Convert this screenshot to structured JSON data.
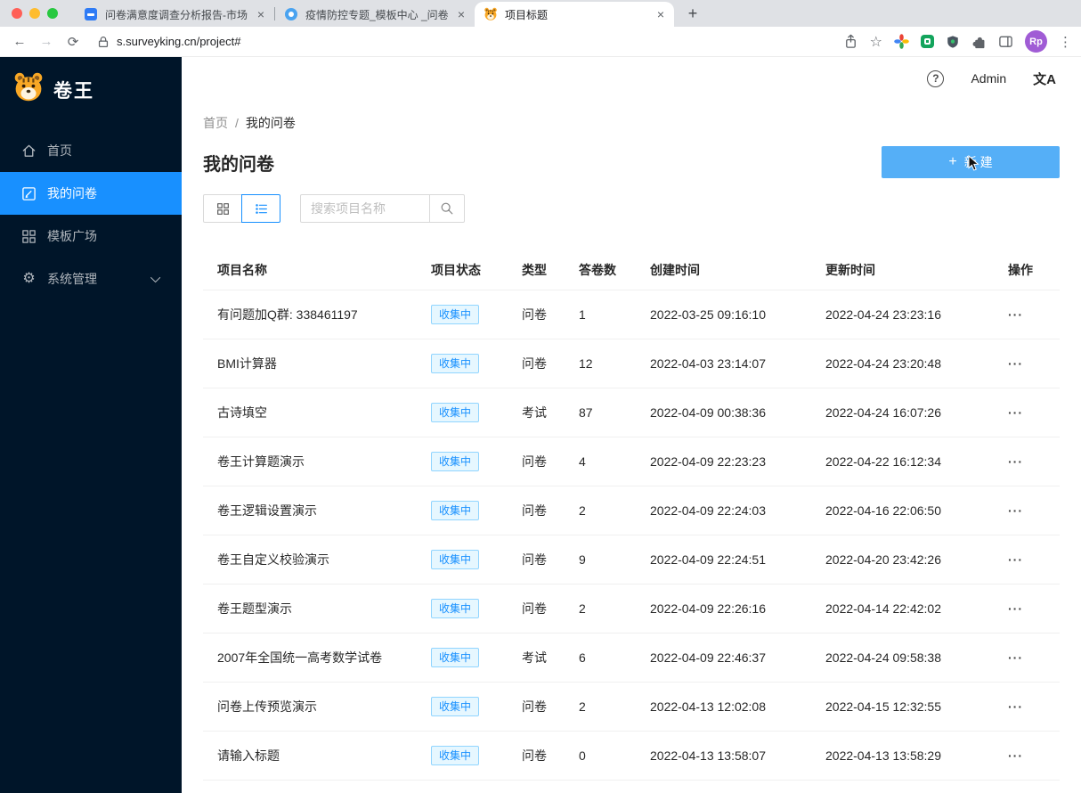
{
  "colors": {
    "accent": "#1890ff",
    "new_button_blue": "#55aff7",
    "badge_bg": "#e6f7ff",
    "badge_border": "#91d5ff",
    "sidebar_bg": "#001529",
    "avatar_purple": "#a05cd5"
  },
  "browser": {
    "tabs": [
      {
        "title": "问卷满意度调查分析报告-市场调"
      },
      {
        "title": "疫情防控专题_模板中心 _问卷网"
      },
      {
        "title": "项目标题"
      }
    ],
    "url": "s.surveyking.cn/project#",
    "avatar_initials": "Rp"
  },
  "icons": {
    "back": "←",
    "forward": "→",
    "refresh": "⟳",
    "star": "☆",
    "overflow": "⋮",
    "close": "×",
    "new_tab": "+",
    "plus": "+",
    "help": "?",
    "translate": "文A",
    "gear": "⚙",
    "more": "···"
  },
  "sidebar": {
    "logo": "卷王",
    "items": [
      {
        "label": "首页"
      },
      {
        "label": "我的问卷"
      },
      {
        "label": "模板广场"
      },
      {
        "label": "系统管理"
      }
    ]
  },
  "header": {
    "user": "Admin"
  },
  "breadcrumb": {
    "home": "首页",
    "separator": "/",
    "current": "我的问卷"
  },
  "page": {
    "title": "我的问卷",
    "new_button": "新 建",
    "search_placeholder": "搜索项目名称"
  },
  "table": {
    "columns": [
      "项目名称",
      "项目状态",
      "类型",
      "答卷数",
      "创建时间",
      "更新时间",
      "操作"
    ],
    "rows": [
      {
        "name": "有问题加Q群: 338461197",
        "status": "收集中",
        "type": "问卷",
        "count": "1",
        "created": "2022-03-25 09:16:10",
        "updated": "2022-04-24 23:23:16"
      },
      {
        "name": "BMI计算器",
        "status": "收集中",
        "type": "问卷",
        "count": "12",
        "created": "2022-04-03 23:14:07",
        "updated": "2022-04-24 23:20:48"
      },
      {
        "name": "古诗填空",
        "status": "收集中",
        "type": "考试",
        "count": "87",
        "created": "2022-04-09 00:38:36",
        "updated": "2022-04-24 16:07:26"
      },
      {
        "name": "卷王计算题演示",
        "status": "收集中",
        "type": "问卷",
        "count": "4",
        "created": "2022-04-09 22:23:23",
        "updated": "2022-04-22 16:12:34"
      },
      {
        "name": "卷王逻辑设置演示",
        "status": "收集中",
        "type": "问卷",
        "count": "2",
        "created": "2022-04-09 22:24:03",
        "updated": "2022-04-16 22:06:50"
      },
      {
        "name": "卷王自定义校验演示",
        "status": "收集中",
        "type": "问卷",
        "count": "9",
        "created": "2022-04-09 22:24:51",
        "updated": "2022-04-20 23:42:26"
      },
      {
        "name": "卷王题型演示",
        "status": "收集中",
        "type": "问卷",
        "count": "2",
        "created": "2022-04-09 22:26:16",
        "updated": "2022-04-14 22:42:02"
      },
      {
        "name": "2007年全国统一高考数学试卷",
        "status": "收集中",
        "type": "考试",
        "count": "6",
        "created": "2022-04-09 22:46:37",
        "updated": "2022-04-24 09:58:38"
      },
      {
        "name": "问卷上传预览演示",
        "status": "收集中",
        "type": "问卷",
        "count": "2",
        "created": "2022-04-13 12:02:08",
        "updated": "2022-04-15 12:32:55"
      },
      {
        "name": "请输入标题",
        "status": "收集中",
        "type": "问卷",
        "count": "0",
        "created": "2022-04-13 13:58:07",
        "updated": "2022-04-13 13:58:29"
      }
    ]
  }
}
